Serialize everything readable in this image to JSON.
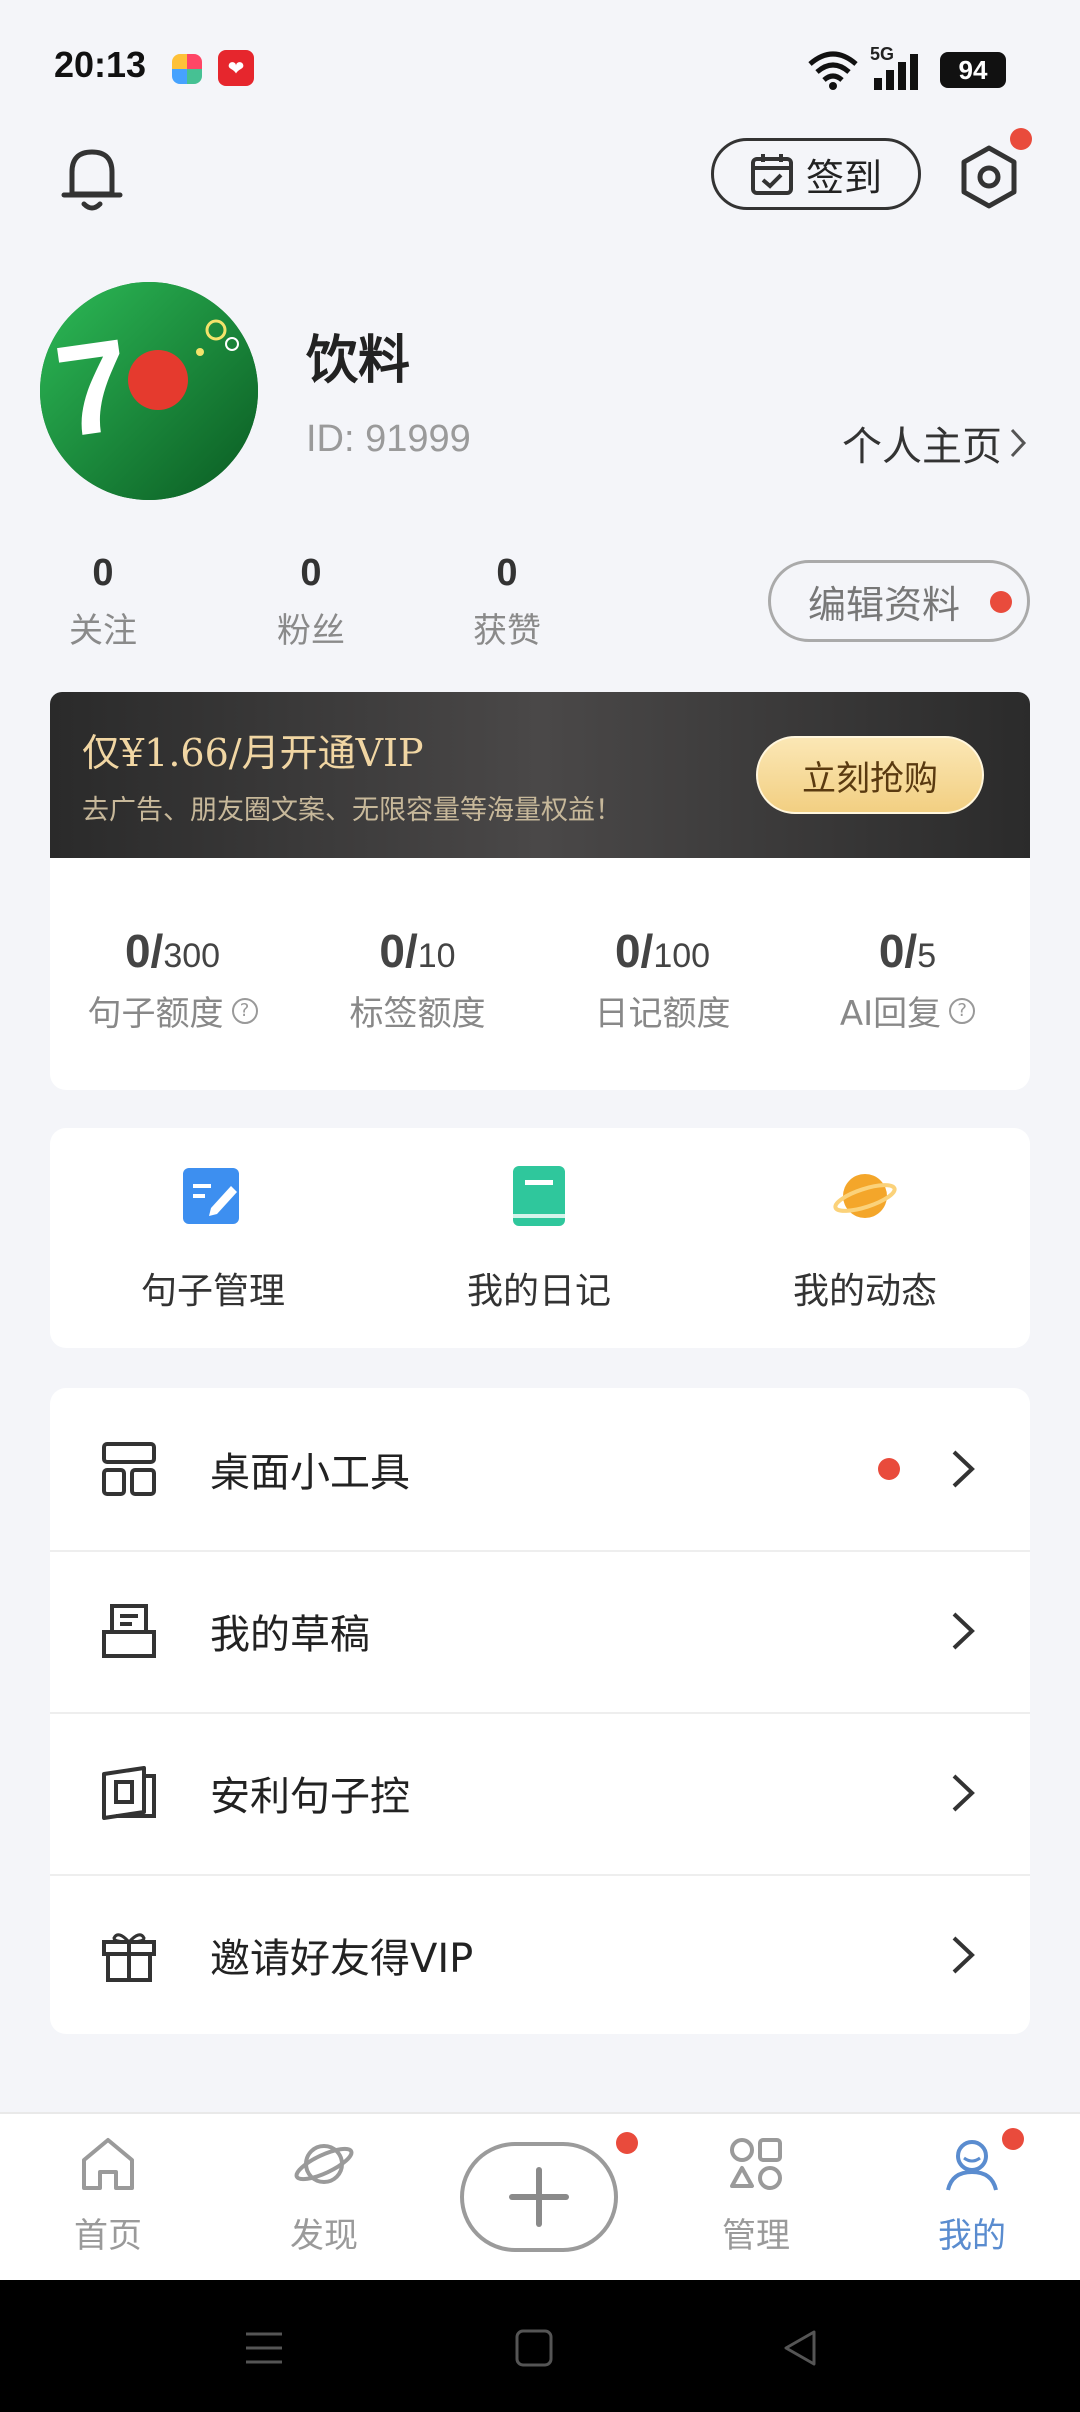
{
  "status_bar": {
    "time": "20:13",
    "battery": "94",
    "network": "5G"
  },
  "header": {
    "checkin_label": "签到"
  },
  "profile": {
    "name": "饮料",
    "id_text": "ID: 91999",
    "homepage_label": "个人主页",
    "edit_label": "编辑资料",
    "stats": [
      {
        "value": "0",
        "label": "关注"
      },
      {
        "value": "0",
        "label": "粉丝"
      },
      {
        "value": "0",
        "label": "获赞"
      }
    ]
  },
  "vip": {
    "title": "仅¥1.66/月开通VIP",
    "subtitle": "去广告、朋友圈文案、无限容量等海量权益！",
    "buy_label": "立刻抢购"
  },
  "quotas": [
    {
      "used": "0/",
      "limit": "300",
      "label": "句子额度",
      "help": true
    },
    {
      "used": "0/",
      "limit": "10",
      "label": "标签额度",
      "help": false
    },
    {
      "used": "0/",
      "limit": "100",
      "label": "日记额度",
      "help": false
    },
    {
      "used": "0/",
      "limit": "5",
      "label": "AI回复",
      "help": true
    }
  ],
  "shortcuts": [
    {
      "label": "句子管理",
      "icon": "edit-note-icon",
      "color": "#3d8ff0"
    },
    {
      "label": "我的日记",
      "icon": "diary-book-icon",
      "color": "#2fc79c"
    },
    {
      "label": "我的动态",
      "icon": "planet-icon",
      "color": "#f4a62a"
    }
  ],
  "menu": [
    {
      "label": "桌面小工具",
      "icon": "widget-icon",
      "has_dot": true
    },
    {
      "label": "我的草稿",
      "icon": "draft-icon",
      "has_dot": false
    },
    {
      "label": "安利句子控",
      "icon": "share-app-icon",
      "has_dot": false
    },
    {
      "label": "邀请好友得VIP",
      "icon": "gift-icon",
      "has_dot": false
    }
  ],
  "bottom_nav": [
    {
      "label": "首页",
      "icon": "home-icon",
      "active": false
    },
    {
      "label": "发现",
      "icon": "discover-icon",
      "active": false
    },
    {
      "label": "管理",
      "icon": "manage-icon",
      "active": false
    },
    {
      "label": "我的",
      "icon": "profile-icon",
      "active": true
    }
  ],
  "colors": {
    "accent": "#5a8ccf",
    "badge": "#e94b3c",
    "vip_gold": "#f1d6a3"
  }
}
